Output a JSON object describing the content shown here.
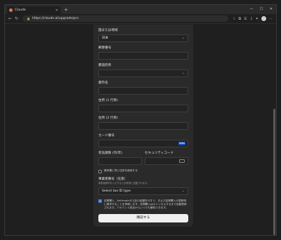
{
  "browser": {
    "tab_title": "Claude",
    "new_tab": "+",
    "window_controls": {
      "min": "—",
      "max": "☐",
      "close": "✕"
    },
    "url": "https://claude.ai/upgrade/pro",
    "nav": {
      "back": "←",
      "forward": "→",
      "reload": "↻"
    },
    "toolbar_icons": [
      "☆",
      "⧉",
      "☰",
      "⇩",
      "✦",
      "⋯"
    ]
  },
  "form": {
    "country_label": "国または地域",
    "country_value": "日本",
    "postal_label": "郵便番号",
    "prefecture_label": "都道府県",
    "city_label": "都市名",
    "address1_label": "住所 (1 行目)",
    "address2_label": "住所 (2 行目)",
    "card_label": "カード番号",
    "card_brand": "VISA",
    "expiry_label": "有効期限 (月/年)",
    "cvc_label": "セキュリティコード",
    "billing_same_label": "請求書に同じ住所を使用する",
    "tax_header": "事業者番号（任意）",
    "tax_subtext": "事業者番号を入力すると請求書に記載されます。",
    "tax_select_value": "Select tax ID type",
    "consent_text": "定期購入、Anthropicが上記の金額を今すぐ、および定期購入の更新時に請求することを承諾します。定期購入はキャンセルするまで自動更新されます。アカウント設定からいつでも解約できます。",
    "submit_label": "購読する",
    "chevron": "⌄",
    "check": "✓"
  }
}
